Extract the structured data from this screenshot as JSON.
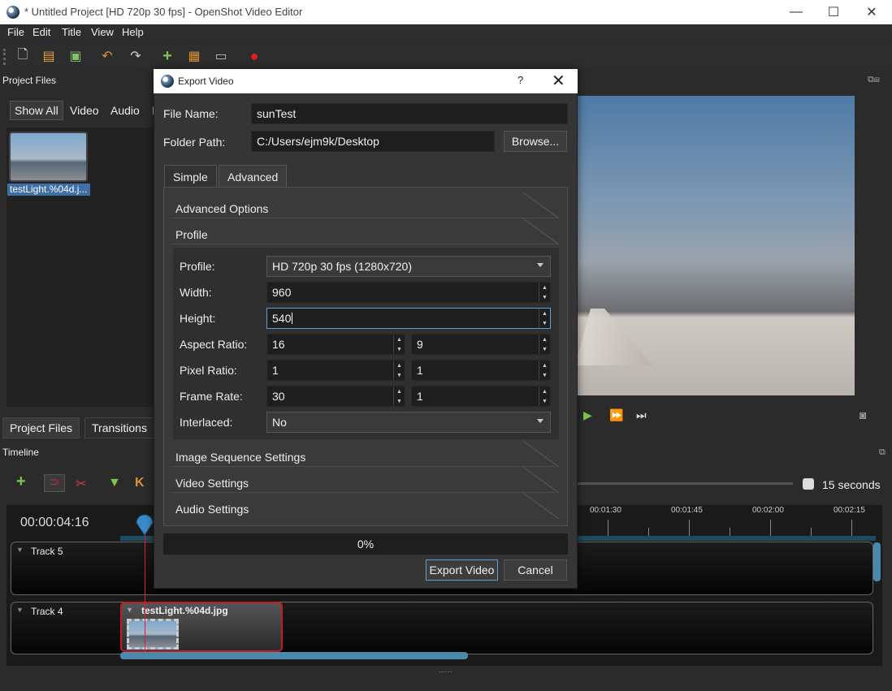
{
  "window": {
    "title": "* Untitled Project [HD 720p 30 fps] - OpenShot Video Editor",
    "minimize": "—",
    "maximize": "☐",
    "close": "✕"
  },
  "menu": [
    "File",
    "Edit",
    "Title",
    "View",
    "Help"
  ],
  "project_files": {
    "header": "Project Files",
    "filters": [
      "Show All",
      "Video",
      "Audio",
      "I"
    ],
    "file_label": "testLight.%04d.j..."
  },
  "bottom_tabs": [
    "Project Files",
    "Transitions"
  ],
  "timeline": {
    "header": "Timeline",
    "timecode": "00:00:04:16",
    "ruler": [
      "00:01:30",
      "00:01:45",
      "00:02:00",
      "00:02:15"
    ],
    "zoom": "15 seconds",
    "tracks": [
      "Track 5",
      "Track 4"
    ],
    "clip": "testLight.%04d.jpg"
  },
  "dialog": {
    "title": "Export Video",
    "help": "?",
    "close": "✕",
    "file_name_label": "File Name:",
    "file_name": "sunTest",
    "folder_label": "Folder Path:",
    "folder": "C:/Users/ejm9k/Desktop",
    "browse": "Browse...",
    "tabs": [
      "Simple",
      "Advanced"
    ],
    "sections": {
      "advanced_options": "Advanced Options",
      "profile": "Profile",
      "image_seq": "Image Sequence Settings",
      "video": "Video Settings",
      "audio": "Audio Settings"
    },
    "profile": {
      "profile_label": "Profile:",
      "profile_value": "HD 720p 30 fps (1280x720)",
      "width_label": "Width:",
      "width": "960",
      "height_label": "Height:",
      "height": "540",
      "aspect_label": "Aspect Ratio:",
      "aspect_num": "16",
      "aspect_den": "9",
      "pixel_label": "Pixel Ratio:",
      "pixel_num": "1",
      "pixel_den": "1",
      "fps_label": "Frame Rate:",
      "fps_num": "30",
      "fps_den": "1",
      "interlaced_label": "Interlaced:",
      "interlaced": "No"
    },
    "progress": "0%",
    "export": "Export Video",
    "cancel": "Cancel"
  }
}
